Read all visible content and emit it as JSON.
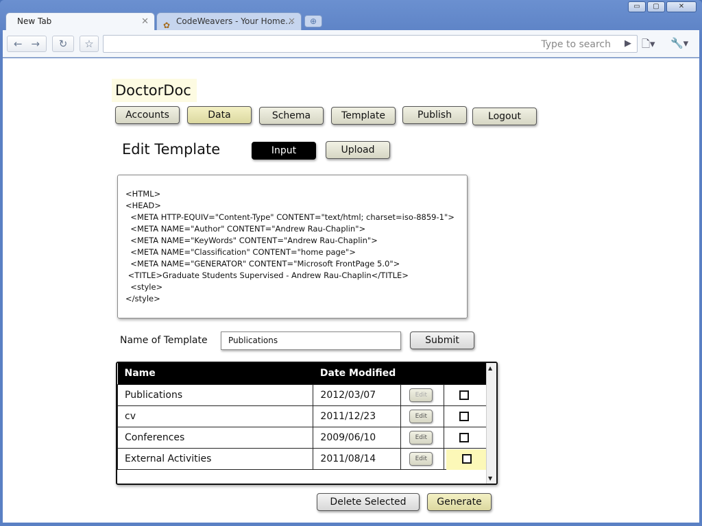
{
  "browser": {
    "tabs": [
      {
        "label": "New Tab",
        "close": "✕"
      },
      {
        "label": "CodeWeavers - Your Home…",
        "close": "✕"
      }
    ],
    "window_controls": {
      "minimize": "▭",
      "maximize": "▢",
      "close": "✕"
    },
    "search_placeholder": "Type to search"
  },
  "app": {
    "brand": "DoctorDoc",
    "nav": [
      "Accounts",
      "Data",
      "Schema",
      "Template",
      "Publish",
      "Logout"
    ],
    "active_nav": "Data"
  },
  "editor": {
    "title": "Edit Template",
    "mode_input": "Input",
    "mode_upload": "Upload",
    "code": "<HTML>\n<HEAD>\n  <META HTTP-EQUIV=\"Content-Type\" CONTENT=\"text/html; charset=iso-8859-1\">\n  <META NAME=\"Author\" CONTENT=\"Andrew Rau-Chaplin\">\n  <META NAME=\"KeyWords\" CONTENT=\"Andrew Rau-Chaplin\">\n  <META NAME=\"Classification\" CONTENT=\"home page\">\n  <META NAME=\"GENERATOR\" CONTENT=\"Microsoft FrontPage 5.0\">\n <TITLE>Graduate Students Supervised - Andrew Rau-Chaplin</TITLE>\n  <style>\n</style>",
    "name_label": "Name of Template",
    "name_value": "Publications",
    "submit": "Submit"
  },
  "templates": {
    "columns": [
      "Name",
      "Date Modified"
    ],
    "edit_label": "Edit",
    "rows": [
      {
        "name": "Publications",
        "date": "2012/03/07"
      },
      {
        "name": "cv",
        "date": "2011/12/23"
      },
      {
        "name": "Conferences",
        "date": "2009/06/10"
      },
      {
        "name": "External Activities",
        "date": "2011/08/14"
      }
    ]
  },
  "actions": {
    "delete": "Delete Selected",
    "generate": "Generate"
  },
  "colors": {
    "highlight": "#fdfbe2",
    "gold_button": "#e8e4b0",
    "header_bg": "#000000"
  }
}
